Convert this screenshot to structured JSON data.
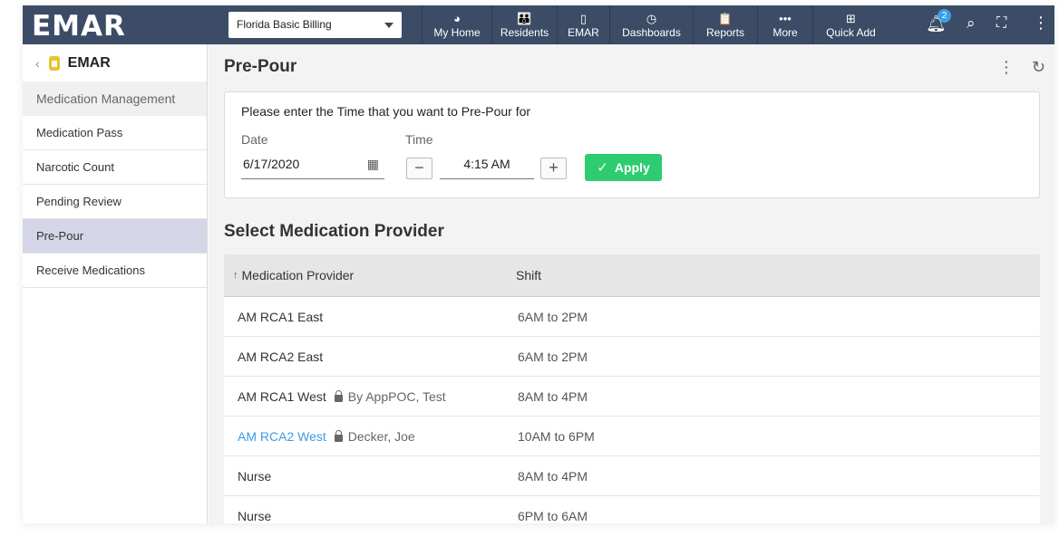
{
  "app": {
    "logo": "EMAR",
    "facility": "Florida Basic Billing"
  },
  "nav": [
    {
      "icon": "dashboard-gauge",
      "glyph": "◕",
      "label": "My Home",
      "width": 77
    },
    {
      "icon": "residents-people",
      "glyph": "👪",
      "label": "Residents",
      "width": 72
    },
    {
      "icon": "emar-bottle",
      "glyph": "▯",
      "label": "EMAR",
      "width": 58
    },
    {
      "icon": "clock",
      "glyph": "◷",
      "label": "Dashboards",
      "width": 92
    },
    {
      "icon": "clipboard",
      "glyph": "📋",
      "label": "Reports",
      "width": 71
    },
    {
      "icon": "more-dots",
      "glyph": "•••",
      "label": "More",
      "width": 61
    },
    {
      "icon": "plus-square",
      "glyph": "⊞",
      "label": "Quick Add",
      "width": 84
    }
  ],
  "notifications": {
    "count": "2"
  },
  "sidebar": {
    "back": "‹",
    "title": "EMAR",
    "items": [
      {
        "label": "Medication Management"
      },
      {
        "label": "Medication Pass"
      },
      {
        "label": "Narcotic Count"
      },
      {
        "label": "Pending Review"
      },
      {
        "label": "Pre-Pour"
      },
      {
        "label": "Receive Medications"
      }
    ]
  },
  "main": {
    "title": "Pre-Pour",
    "prompt": "Please enter the Time that you want to Pre-Pour for",
    "date_label": "Date",
    "date_value": "6/17/2020",
    "time_label": "Time",
    "time_value": "4:15 AM",
    "minus": "−",
    "plus": "+",
    "apply_label": "Apply",
    "section_title": "Select  Medication Provider"
  },
  "table": {
    "headers": {
      "provider": "Medication Provider",
      "shift": "Shift",
      "sort_glyph": "↑"
    },
    "rows": [
      {
        "provider": "AM RCA1 East",
        "locked_by": "",
        "shift": "6AM to 2PM",
        "link": false
      },
      {
        "provider": "AM RCA2 East",
        "locked_by": "",
        "shift": "6AM to 2PM",
        "link": false
      },
      {
        "provider": "AM RCA1 West",
        "locked_by": "By AppPOC, Test",
        "shift": "8AM to 4PM",
        "link": false
      },
      {
        "provider": "AM RCA2 West",
        "locked_by": "Decker, Joe",
        "shift": "10AM to 6PM",
        "link": true
      },
      {
        "provider": "Nurse",
        "locked_by": "",
        "shift": "8AM to 4PM",
        "link": false
      },
      {
        "provider": "Nurse",
        "locked_by": "",
        "shift": "6PM to 6AM",
        "link": false
      }
    ]
  },
  "colors": {
    "topbar": "#3c4c66",
    "accent": "#3d9be3",
    "apply": "#2ecc71",
    "active_item": "#d4d5e6"
  }
}
